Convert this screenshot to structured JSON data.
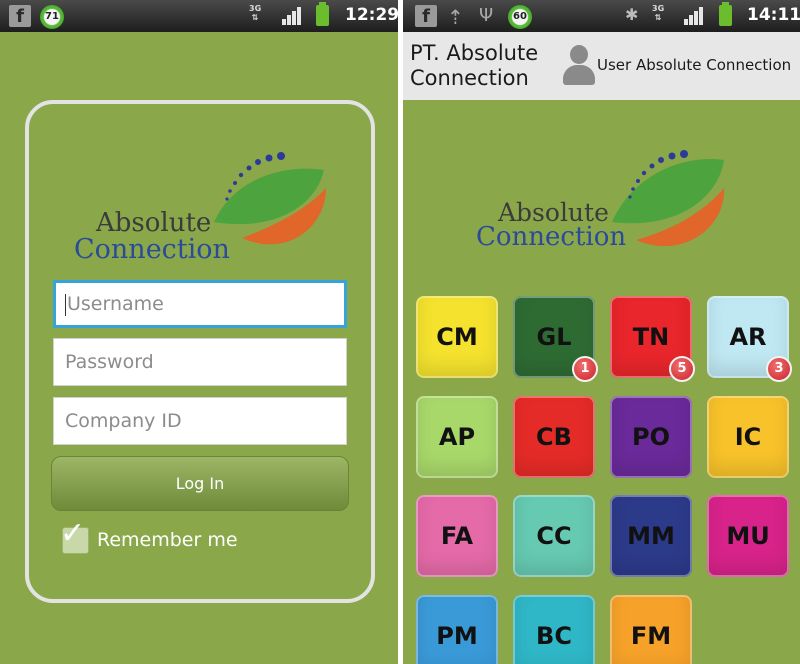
{
  "left": {
    "status_bar": {
      "time": "12:29",
      "notification_count": "71",
      "network": "3G"
    },
    "logo": {
      "line1": "Absolute",
      "line2": "Connection"
    },
    "form": {
      "username_placeholder": "Username",
      "password_placeholder": "Password",
      "company_placeholder": "Company ID",
      "login_label": "Log In",
      "remember_label": "Remember me",
      "remember_checked": true
    }
  },
  "right": {
    "status_bar": {
      "time": "14:11",
      "notification_count": "60",
      "network": "3G"
    },
    "app_bar": {
      "company_line1": "PT. Absolute",
      "company_line2": "Connection",
      "user_label": "User Absolute Connection"
    },
    "logo": {
      "line1": "Absolute",
      "line2": "Connection"
    },
    "modules": [
      {
        "code": "CM",
        "color": "#f4e22e"
      },
      {
        "code": "GL",
        "color": "#2e6b33",
        "badge": "1"
      },
      {
        "code": "TN",
        "color": "#e8262b",
        "badge": "5"
      },
      {
        "code": "AR",
        "color": "#bfe8f3",
        "badge": "3"
      },
      {
        "code": "AP",
        "color": "#a8d86a"
      },
      {
        "code": "CB",
        "color": "#e52b27"
      },
      {
        "code": "PO",
        "color": "#6a2a9a"
      },
      {
        "code": "IC",
        "color": "#f7c22a"
      },
      {
        "code": "FA",
        "color": "#e46aa8"
      },
      {
        "code": "CC",
        "color": "#66c9b2"
      },
      {
        "code": "MM",
        "color": "#2c3a8a"
      },
      {
        "code": "MU",
        "color": "#d8238a"
      },
      {
        "code": "PM",
        "color": "#3a9ad8"
      },
      {
        "code": "BC",
        "color": "#2fb7c7"
      },
      {
        "code": "FM",
        "color": "#f6a22a"
      }
    ]
  },
  "colors": {
    "background_green": "#8aa84a",
    "focus_blue": "#36a3d9"
  }
}
